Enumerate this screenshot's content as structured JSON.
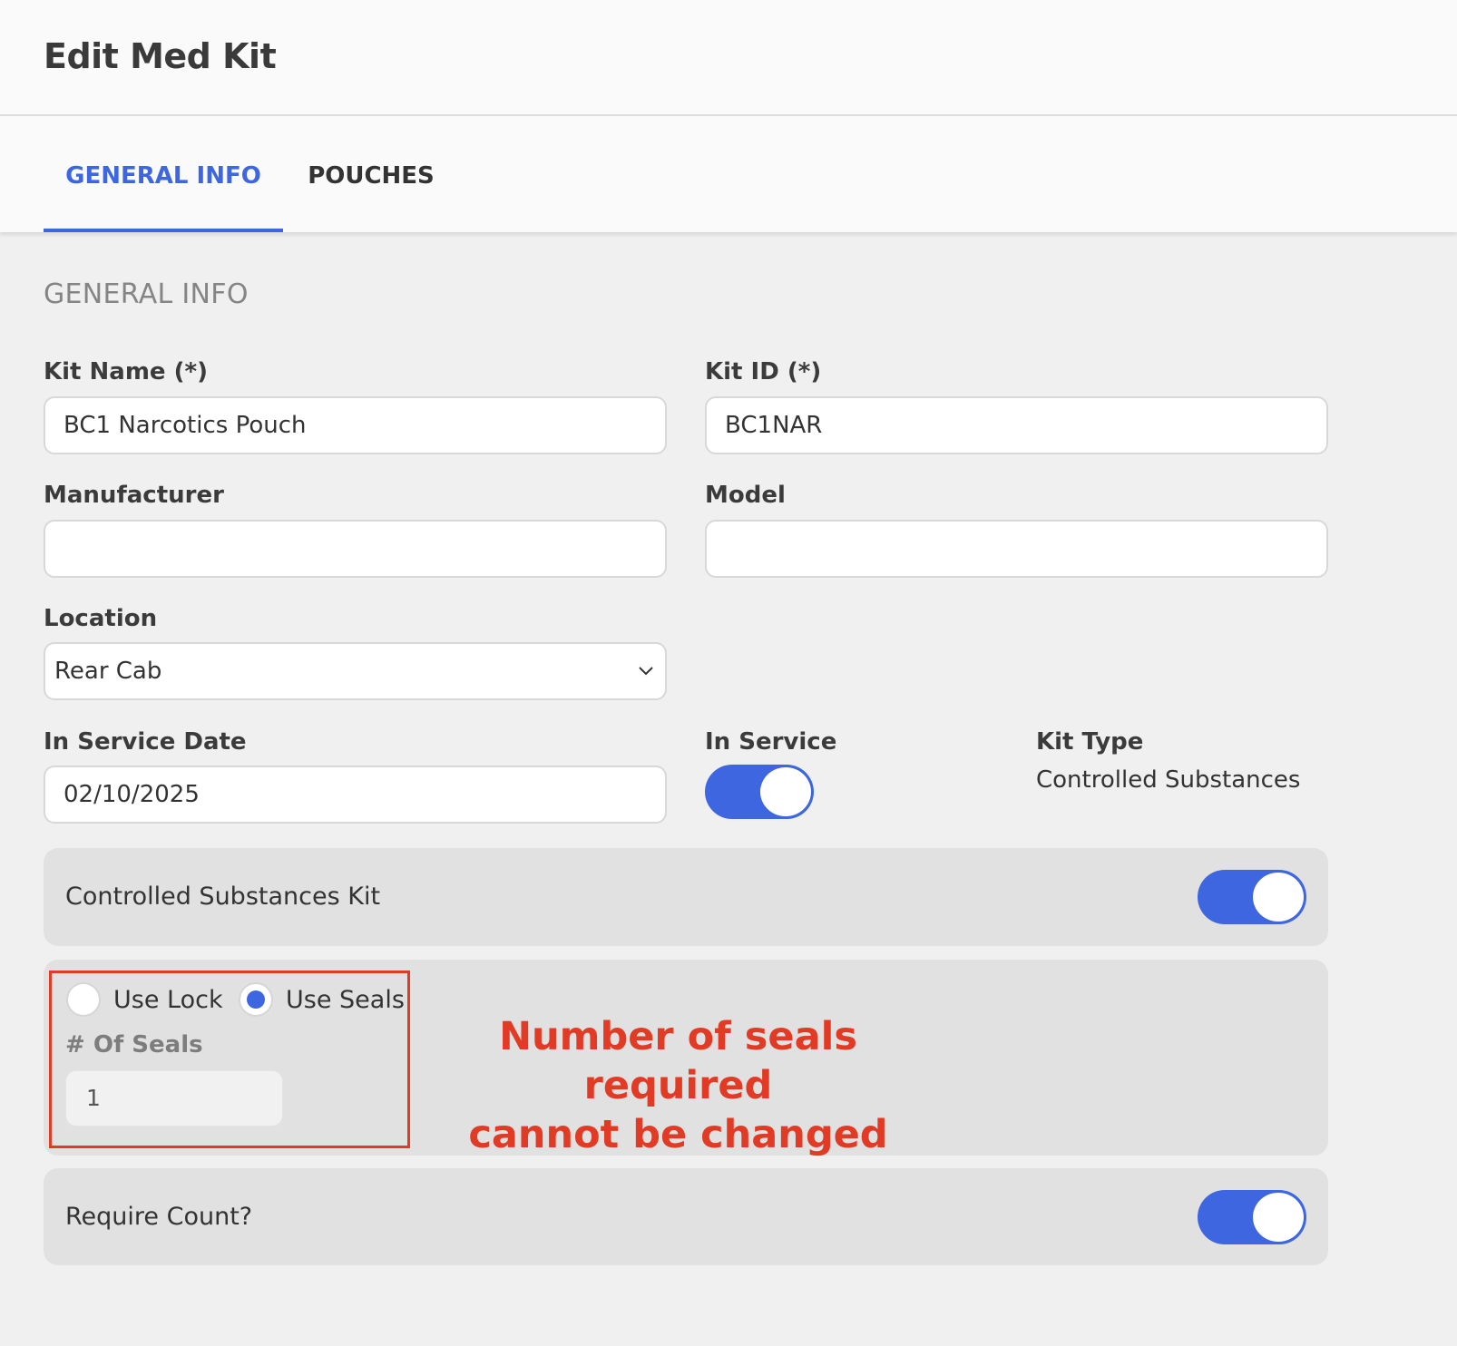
{
  "header": {
    "title": "Edit Med Kit"
  },
  "tabs": [
    {
      "label": "GENERAL INFO",
      "active": true
    },
    {
      "label": "POUCHES",
      "active": false
    }
  ],
  "section": {
    "title": "GENERAL INFO"
  },
  "fields": {
    "kit_name": {
      "label": "Kit Name (*)",
      "value": "BC1 Narcotics Pouch"
    },
    "kit_id": {
      "label": "Kit ID (*)",
      "value": "BC1NAR"
    },
    "manufacturer": {
      "label": "Manufacturer",
      "value": ""
    },
    "model": {
      "label": "Model",
      "value": ""
    },
    "location": {
      "label": "Location",
      "value": "Rear Cab"
    },
    "in_service_date": {
      "label": "In Service Date",
      "value": "02/10/2025"
    },
    "in_service": {
      "label": "In Service",
      "on": true
    },
    "kit_type": {
      "label": "Kit Type",
      "value": "Controlled Substances"
    }
  },
  "controlled_substances": {
    "label": "Controlled Substances Kit",
    "on": true
  },
  "security": {
    "use_lock_label": "Use Lock",
    "use_seals_label": "Use Seals",
    "selected": "Use Seals",
    "seals_label": "# Of Seals",
    "seals_value": "1"
  },
  "annotation": {
    "line1": "Number of seals required",
    "line2": "cannot be changed",
    "color": "#e23b25"
  },
  "require_count": {
    "label": "Require Count?",
    "on": true
  },
  "colors": {
    "accent": "#3d66e0"
  },
  "icons": {
    "select_arrow": "chevron-down-icon"
  }
}
